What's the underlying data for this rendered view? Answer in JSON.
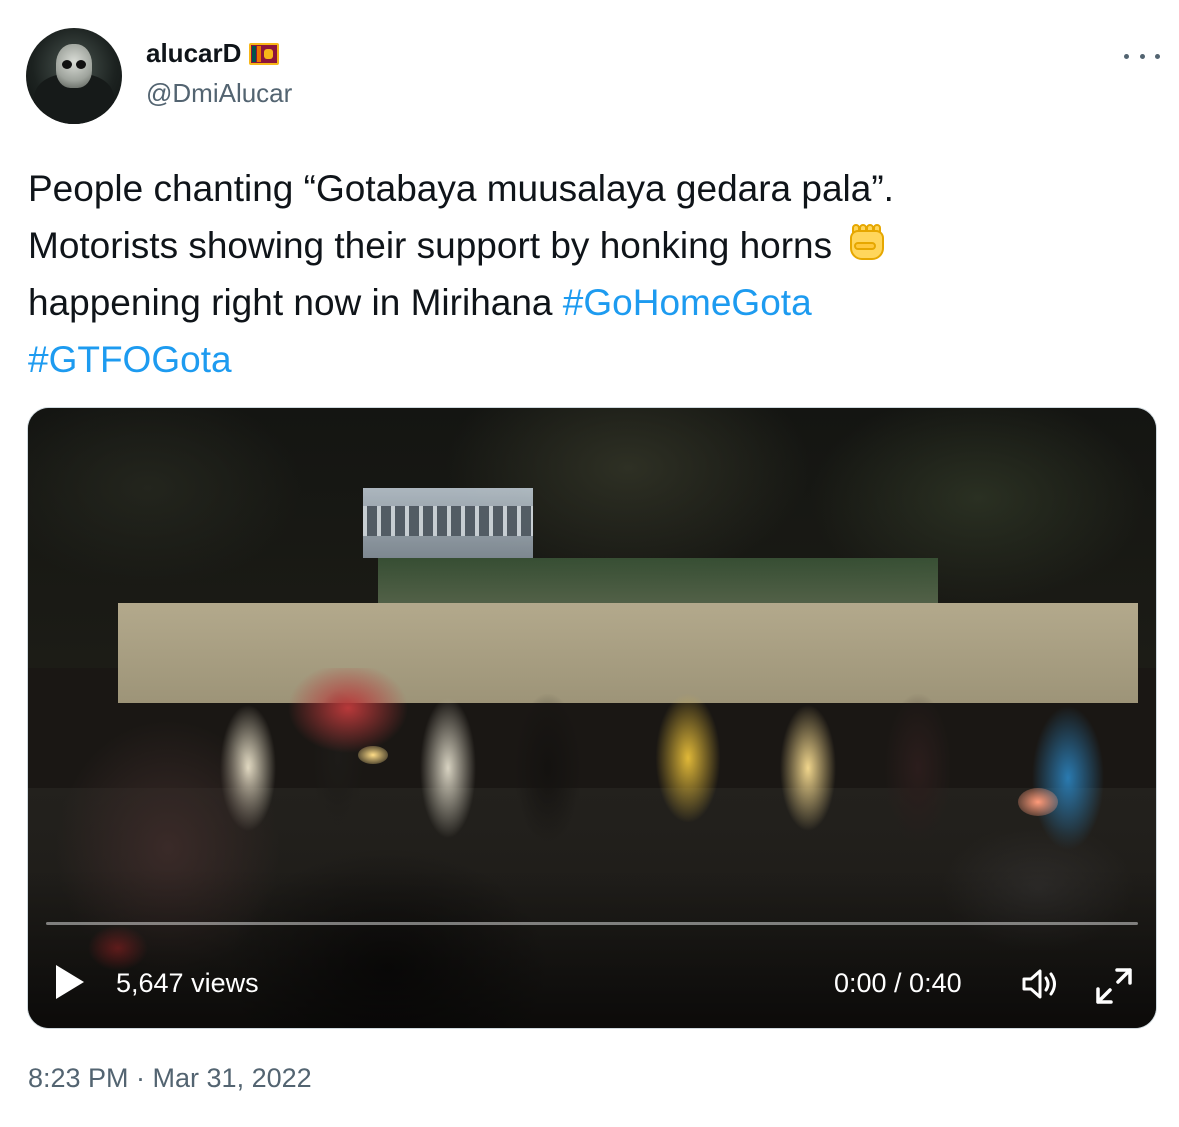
{
  "user": {
    "display_name": "alucarD",
    "handle": "@DmiAlucar",
    "flag_icon": "sri-lanka-flag-icon"
  },
  "more_icon": "more-horizontal-icon",
  "tweet": {
    "line1": "People chanting “Gotabaya muusalaya gedara pala”.",
    "line2": "Motorists showing their support by honking horns",
    "emoji": "raised-fist-emoji",
    "line3": "happening right now in Mirihana",
    "hashtags": [
      "#GoHomeGota",
      "#GTFOGota"
    ]
  },
  "video": {
    "views": "5,647 views",
    "time": "0:00 / 0:40",
    "progress": 0,
    "play_icon": "play-icon",
    "volume_icon": "volume-icon",
    "fullscreen_icon": "fullscreen-icon"
  },
  "timestamp": "8:23 PM · Mar 31, 2022",
  "colors": {
    "text": "#0f1419",
    "secondary": "#536471",
    "link": "#1d9bf0",
    "border": "#cfd9de"
  }
}
